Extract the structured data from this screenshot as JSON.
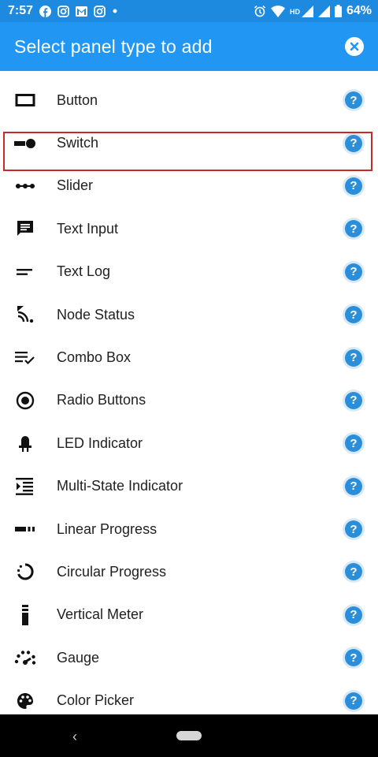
{
  "status_bar": {
    "time": "7:57",
    "battery": "64%",
    "network": "HD",
    "left_icons": [
      "facebook-icon",
      "instagram-icon",
      "gmail-icon",
      "instagram-icon",
      "dot-icon"
    ],
    "right_icons": [
      "alarm-icon",
      "wifi-icon",
      "signal-icon",
      "signal-icon",
      "battery-icon"
    ]
  },
  "header": {
    "title": "Select panel type to add",
    "close_icon": "close-icon"
  },
  "items": [
    {
      "label": "Button",
      "icon": "button-icon"
    },
    {
      "label": "Switch",
      "icon": "switch-icon"
    },
    {
      "label": "Slider",
      "icon": "slider-icon"
    },
    {
      "label": "Text Input",
      "icon": "text-input-icon"
    },
    {
      "label": "Text Log",
      "icon": "text-log-icon"
    },
    {
      "label": "Node Status",
      "icon": "node-status-icon"
    },
    {
      "label": "Combo Box",
      "icon": "combo-box-icon"
    },
    {
      "label": "Radio Buttons",
      "icon": "radio-buttons-icon"
    },
    {
      "label": "LED Indicator",
      "icon": "led-indicator-icon"
    },
    {
      "label": "Multi-State Indicator",
      "icon": "multi-state-indicator-icon"
    },
    {
      "label": "Linear Progress",
      "icon": "linear-progress-icon"
    },
    {
      "label": "Circular Progress",
      "icon": "circular-progress-icon"
    },
    {
      "label": "Vertical Meter",
      "icon": "vertical-meter-icon"
    },
    {
      "label": "Gauge",
      "icon": "gauge-icon"
    },
    {
      "label": "Color Picker",
      "icon": "color-picker-icon"
    }
  ],
  "help_glyph": "?",
  "highlighted_item": "Text Input",
  "colors": {
    "accent": "#2196f3",
    "status_bar": "#1d89df",
    "help": "#2a8fd8",
    "highlight": "#c42b2b"
  },
  "nav": {
    "back_glyph": "‹"
  }
}
